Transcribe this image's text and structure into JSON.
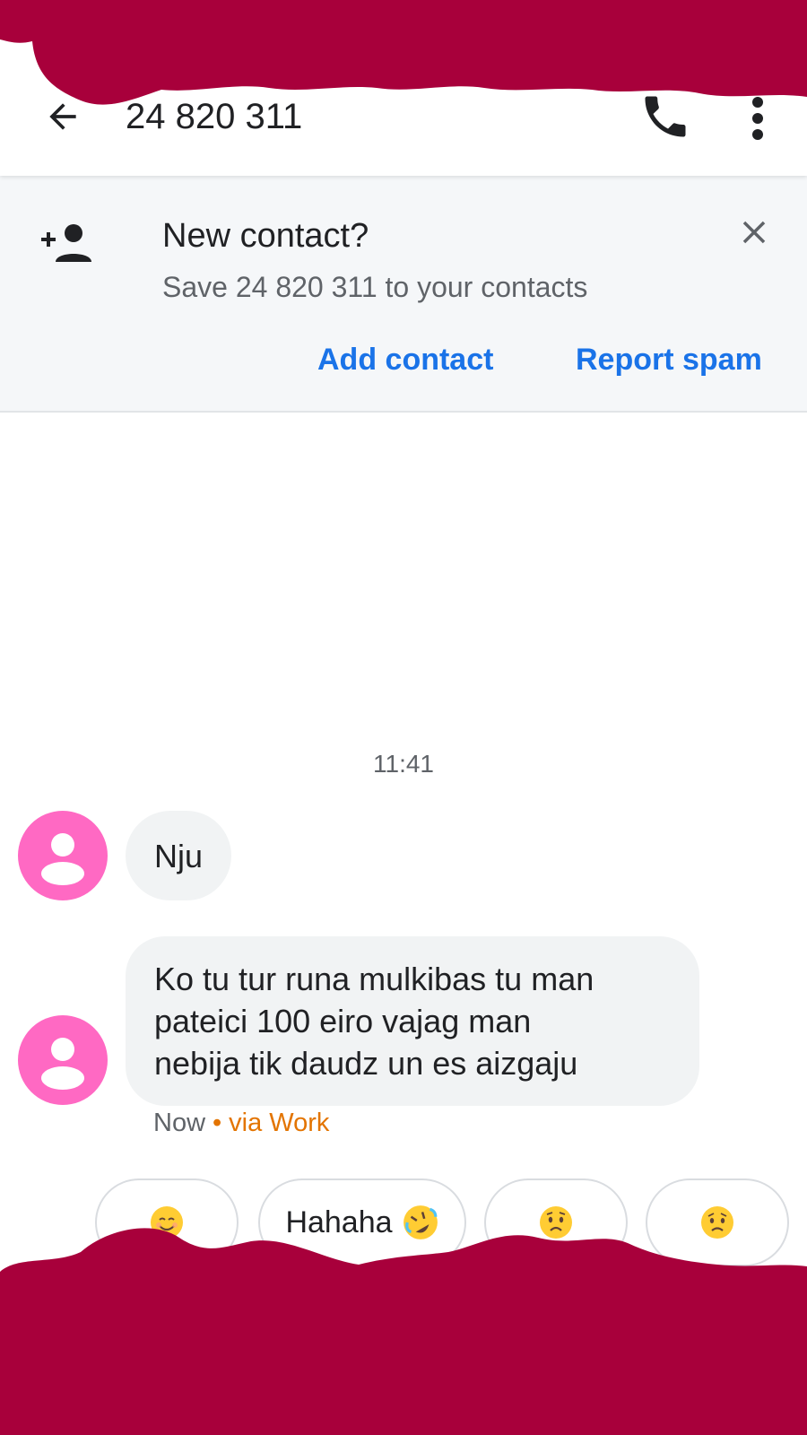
{
  "app_bar": {
    "title": "24 820 311",
    "back_icon": "arrow-back-icon",
    "call_icon": "phone-icon",
    "more_icon": "more-vert-icon"
  },
  "banner": {
    "icon": "person-add-icon",
    "title": "New contact?",
    "subtitle": "Save 24 820 311 to your contacts",
    "close_icon": "close-icon",
    "add_contact_label": "Add contact",
    "report_spam_label": "Report spam"
  },
  "conversation": {
    "timestamp": "11:41",
    "messages": [
      {
        "text": "Nju"
      },
      {
        "text": "Ko tu tur runa mulkibas tu man\npateici 100 eiro vajag man\nnebija tik daudz un es aizgaju"
      }
    ],
    "meta_time": "Now",
    "meta_separator": "•",
    "meta_via": "via Work"
  },
  "suggestions": [
    {
      "label": "",
      "emoji": "smiling-face-emoji"
    },
    {
      "label": "Hahaha",
      "emoji": "rolling-on-floor-laughing-emoji"
    },
    {
      "label": "",
      "emoji": "worried-face-emoji"
    },
    {
      "label": "",
      "emoji": "sad-face-emoji"
    }
  ],
  "colors": {
    "accent": "#1a73e8",
    "avatar": "#ff69c3",
    "via_work": "#e37400",
    "redaction": "#a8003b"
  }
}
